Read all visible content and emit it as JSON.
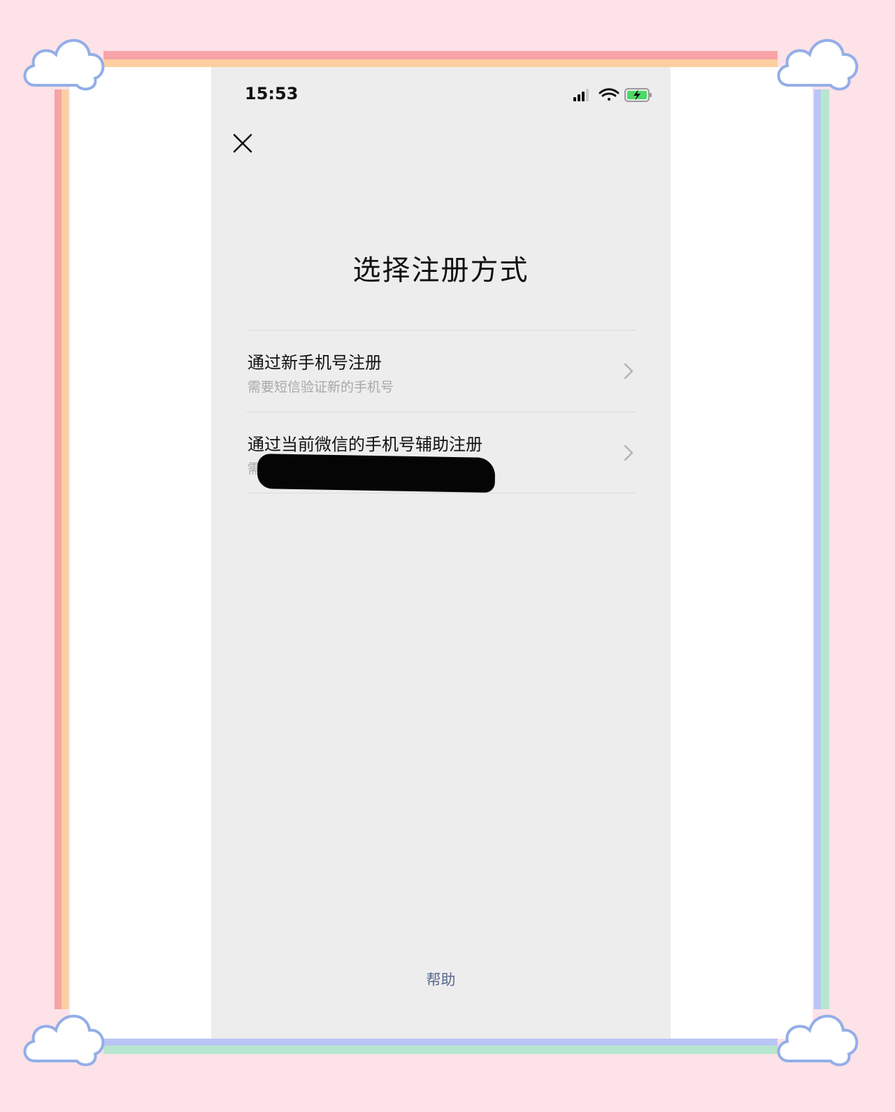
{
  "status_bar": {
    "time": "15:53"
  },
  "title": "选择注册方式",
  "options": [
    {
      "title": "通过新手机号注册",
      "subtitle": "需要短信验证新的手机号"
    },
    {
      "title": "通过当前微信的手机号辅助注册",
      "subtitle": "需"
    }
  ],
  "help_label": "帮助",
  "icons": {
    "close": "close-icon",
    "chevron": "chevron-right-icon",
    "signal": "signal-icon",
    "wifi": "wifi-icon",
    "battery": "battery-charging-icon"
  },
  "colors": {
    "page_bg": "#fde2e8",
    "phone_bg": "#ededed",
    "help_link": "#56698f",
    "battery_green": "#4cd964"
  }
}
